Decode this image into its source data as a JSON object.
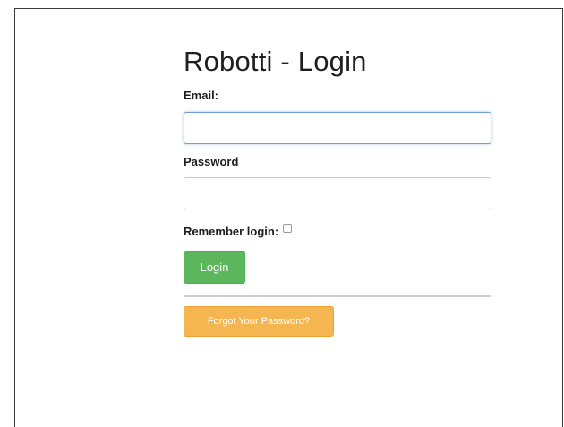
{
  "login": {
    "title": "Robotti - Login",
    "email_label": "Email:",
    "email_value": "",
    "password_label": "Password",
    "password_value": "",
    "remember_label": "Remember login:",
    "remember_checked": false,
    "login_button_label": "Login",
    "forgot_button_label": "Forgot Your Password?"
  },
  "colors": {
    "login_button": "#5cb65c",
    "forgot_button": "#f5b651",
    "focused_input_border": "#6f9fd6",
    "divider": "#d0d0d0"
  }
}
